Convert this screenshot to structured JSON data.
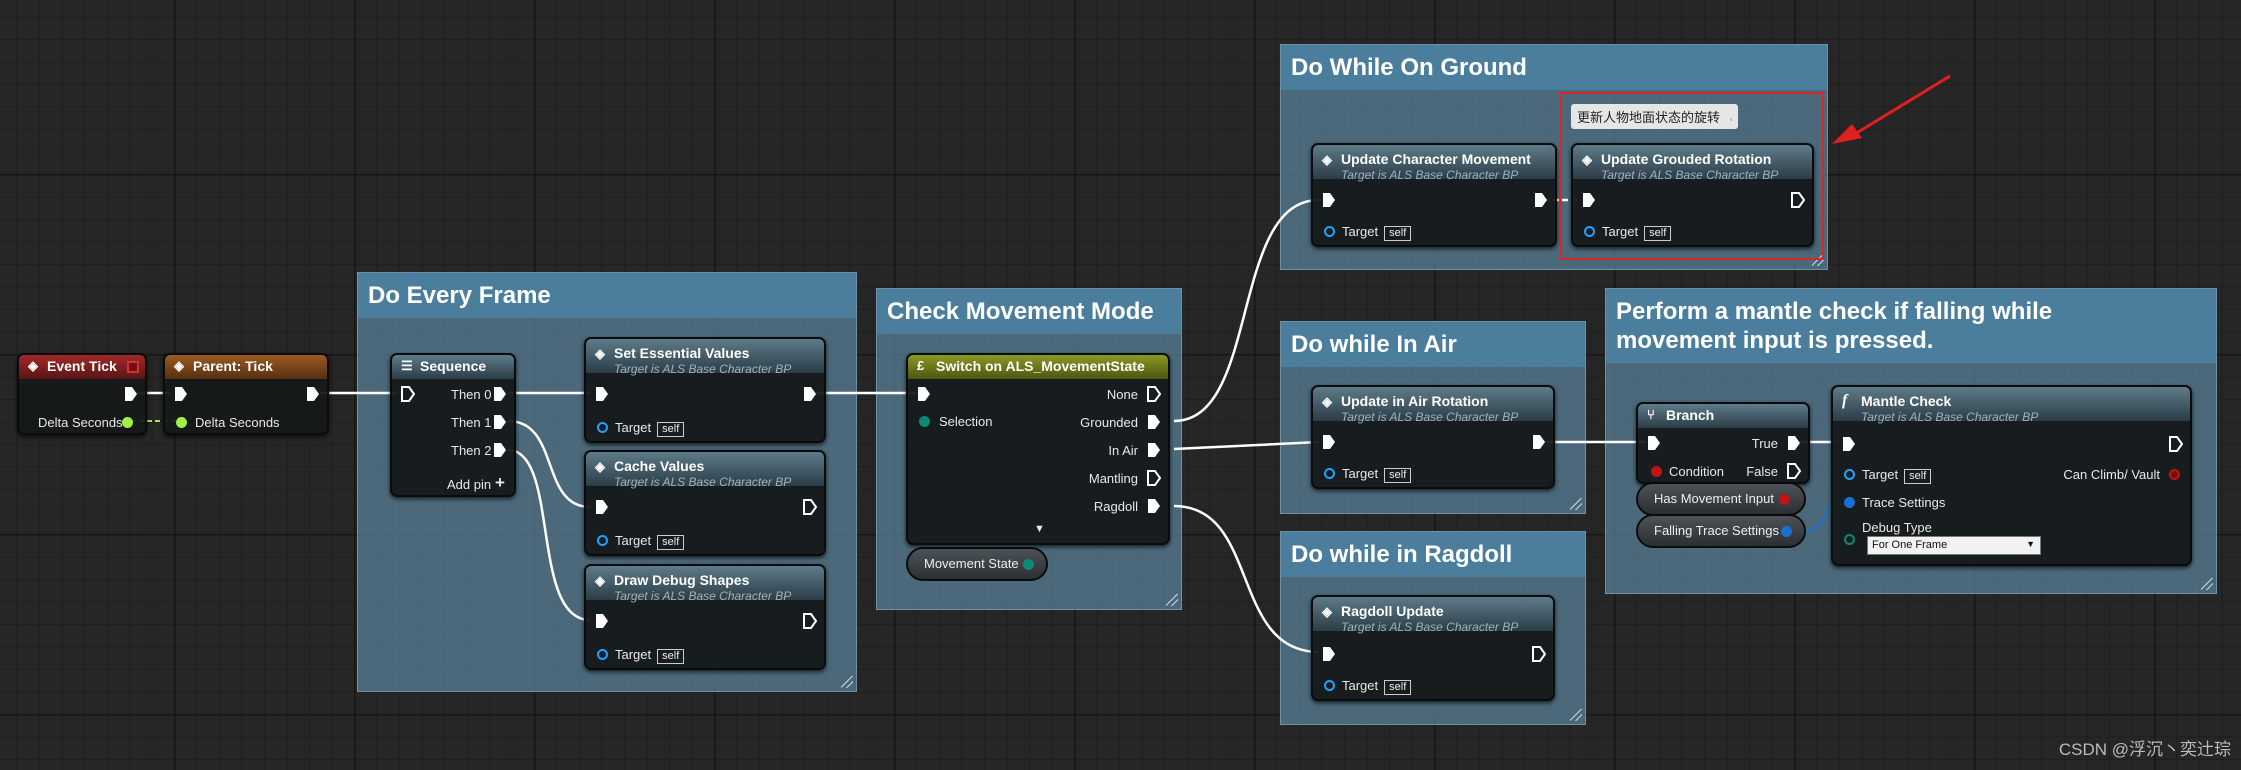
{
  "comments": {
    "every_frame": "Do Every Frame",
    "movement_mode": "Check Movement Mode",
    "on_ground": "Do While On Ground",
    "in_air": "Do while In Air",
    "ragdoll": "Do while in Ragdoll",
    "mantle": "Perform a mantle check if falling while movement input is pressed."
  },
  "nodes": {
    "event_tick": {
      "title": "Event Tick",
      "pin": "Delta Seconds"
    },
    "parent_tick": {
      "title": "Parent: Tick",
      "pin": "Delta Seconds"
    },
    "sequence": {
      "title": "Sequence",
      "pins": [
        "Then 0",
        "Then 1",
        "Then 2"
      ],
      "add_pin": "Add pin"
    },
    "set_essential": {
      "title": "Set Essential Values",
      "subtitle": "Target is ALS Base Character BP",
      "target": "Target",
      "self": "self"
    },
    "cache_values": {
      "title": "Cache Values",
      "subtitle": "Target is ALS Base Character BP",
      "target": "Target",
      "self": "self"
    },
    "draw_debug": {
      "title": "Draw Debug Shapes",
      "subtitle": "Target is ALS Base Character BP",
      "target": "Target",
      "self": "self"
    },
    "switch": {
      "title": "Switch on ALS_MovementState",
      "selection": "Selection",
      "outputs": [
        "None",
        "Grounded",
        "In Air",
        "Mantling",
        "Ragdoll"
      ]
    },
    "movement_state": {
      "label": "Movement State"
    },
    "update_char_movement": {
      "title": "Update Character Movement",
      "subtitle": "Target is ALS Base Character BP",
      "target": "Target",
      "self": "self"
    },
    "update_grounded": {
      "title": "Update Grouded Rotation",
      "subtitle": "Target is ALS Base Character BP",
      "target": "Target",
      "self": "self",
      "tooltip": "更新人物地面状态的旋转"
    },
    "update_air_rotation": {
      "title": "Update in Air Rotation",
      "subtitle": "Target is ALS Base Character BP",
      "target": "Target",
      "self": "self"
    },
    "ragdoll_update": {
      "title": "Ragdoll Update",
      "subtitle": "Target is ALS Base Character BP",
      "target": "Target",
      "self": "self"
    },
    "branch": {
      "title": "Branch",
      "condition": "Condition",
      "true_pin": "True",
      "false_pin": "False"
    },
    "has_movement_input": {
      "label": "Has Movement Input"
    },
    "falling_trace": {
      "label": "Falling Trace Settings"
    },
    "mantle_check": {
      "title": "Mantle Check",
      "subtitle": "Target is ALS Base Character BP",
      "target": "Target",
      "self": "self",
      "can_climb": "Can Climb/ Vault",
      "trace": "Trace Settings",
      "debug_type": "Debug Type",
      "debug_value": "For One Frame"
    }
  },
  "watermark": "CSDN @浮沉丶奕辻琮",
  "colors": {
    "exec_pin": "#ffffff",
    "object_pin": "#1fa2ff",
    "float_pin": "#a2f046",
    "bool_pin": "#c01414",
    "struct_pin": "#1b6fd1",
    "enum_pin": "#0b8a74",
    "event_header": "#8b1c1c",
    "parent_header": "#8a4a1c",
    "switch_header": "#6b7a19",
    "highlight": "#d62828"
  },
  "icons": {
    "event": "event-diamond-icon",
    "function": "function-f-icon",
    "branch": "branch-icon",
    "sequence": "sequence-icon",
    "annotation_arrow": "red-arrow-icon"
  }
}
